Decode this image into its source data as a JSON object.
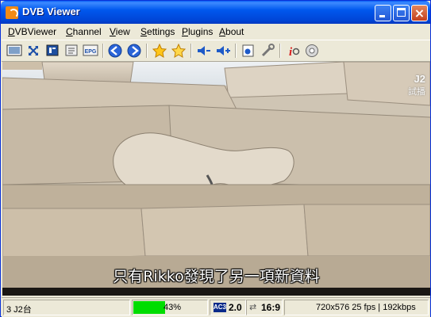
{
  "window": {
    "title": "DVB Viewer"
  },
  "menu": [
    "DVBViewer",
    "Channel",
    "View",
    "Settings",
    "Plugins",
    "About"
  ],
  "toolbar": {
    "buttons": [
      "monitor-icon",
      "fullscreen-icon",
      "teletext-icon",
      "osd-icon",
      "epg-icon",
      "back-icon",
      "forward-icon",
      "favorite-icon",
      "favorites-icon",
      "volume-down-icon",
      "volume-up-icon",
      "record-icon",
      "settings-icon",
      "info-icon",
      "disc-icon"
    ],
    "epg_label": "EPG"
  },
  "video": {
    "watermark_top": "J2",
    "watermark_bottom": "試播",
    "subtitle": "只有Rikko發現了另一項新資料"
  },
  "status": {
    "channel": "3 J2台",
    "signal_percent": 43,
    "signal_label": "43%",
    "audio_codec": "AC3",
    "audio_channels": "2.0",
    "aspect": "16:9",
    "resolution_info": "720x576 25 fps | 192kbps"
  },
  "colors": {
    "titlebar": "#0058ee",
    "signal": "#00dd00"
  }
}
